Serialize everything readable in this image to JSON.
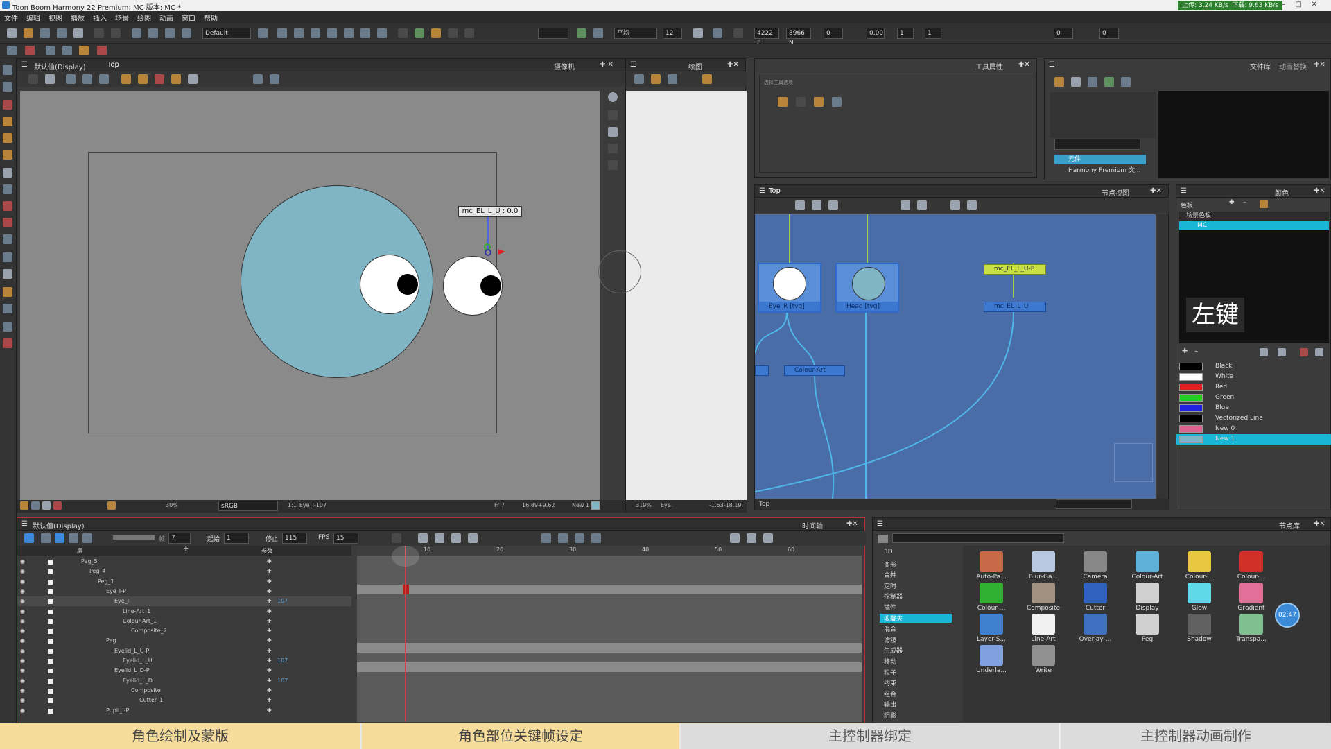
{
  "window": {
    "title": "Toon Boom Harmony 22 Premium: MC 版本: MC *",
    "net_up": "上传: 3.24 KB/s",
    "net_down": "下载: 9.63 KB/s"
  },
  "menu": [
    "文件",
    "编辑",
    "视图",
    "播放",
    "插入",
    "场景",
    "绘图",
    "动画",
    "窗口",
    "帮助"
  ],
  "toolbar": {
    "workspace": "Default",
    "smooth": "平均",
    "brush_size": "12",
    "coord_e": "4222 E",
    "coord_n": "8966 N",
    "f1": "0",
    "f2": "0.00",
    "f3": "1",
    "f4": "1",
    "f5": "0",
    "f6": "0"
  },
  "camera_panel": {
    "view_mode": "默认值(Display)",
    "tab": "Top",
    "title": "摄像机",
    "tooltip": "mc_EL_L_U : 0.0",
    "zoom": "30%",
    "color_space": "sRGB",
    "layer": "1:1_Eye_I-107",
    "frame_info": "Fr 7",
    "coords": "16.89+9.62",
    "new_label": "New 1"
  },
  "drawing_panel": {
    "title": "绘图",
    "zoom": "319%",
    "layer": "Eye_",
    "coords": "-1.63-18.19"
  },
  "tool_props": {
    "title": "工具属性",
    "subtitle": "选择工具选项"
  },
  "library_panel": {
    "title1": "文件库",
    "title2": "动画替换",
    "item1": "元件",
    "item2": "Harmony Premium 文..."
  },
  "node_view": {
    "tab": "Top",
    "title": "节点视图",
    "footer": "Top",
    "nodes": [
      "Eye_R [tvg]",
      "Head [tvg]",
      "mc_EL_L_U-P",
      "mc_EL_L_U",
      "Colour-Art"
    ]
  },
  "colour_panel": {
    "title": "颜色",
    "palette_tab": "色板",
    "scene_palette": "场景色板",
    "palette_item": "MC",
    "overlay_key": "左键",
    "swatches": [
      {
        "name": "Black",
        "color": "#000000"
      },
      {
        "name": "White",
        "color": "#ffffff"
      },
      {
        "name": "Red",
        "color": "#e02020"
      },
      {
        "name": "Green",
        "color": "#20d020"
      },
      {
        "name": "Blue",
        "color": "#2020e0"
      },
      {
        "name": "Vectorized Line",
        "color": "#000000"
      },
      {
        "name": "New 0",
        "color": "#e06090"
      },
      {
        "name": "New 1",
        "color": "#7fb5c4"
      }
    ]
  },
  "timeline": {
    "view_mode": "默认值(Display)",
    "title": "时间轴",
    "frame": "7",
    "start_label": "起始",
    "start": "1",
    "stop_label": "停止",
    "stop": "115",
    "fps_label": "FPS",
    "fps": "15",
    "col_layers": "层",
    "col_params": "参数",
    "ruler": [
      "10",
      "20",
      "30",
      "40",
      "50",
      "60"
    ],
    "layers": [
      "Peg_5",
      "Peg_4",
      "Peg_1",
      "Eye_I-P",
      "Eye_I",
      "Line-Art_1",
      "Colour-Art_1",
      "Composite_2",
      "Peg",
      "Eyelid_L_U-P",
      "Eyelid_L_U",
      "Eyelid_L_D-P",
      "Eyelid_L_D",
      "Composite",
      "Cutter_1",
      "Pupil_I-P"
    ],
    "layer_nums": {
      "4": "107",
      "10": "107",
      "12": "107"
    }
  },
  "node_library": {
    "title": "节点库",
    "categories": [
      "3D",
      "变形",
      "合并",
      "定时",
      "控制器",
      "插件",
      "收藏夹",
      "混合",
      "滤镜",
      "生成器",
      "移动",
      "粒子",
      "约束",
      "组合",
      "输出",
      "阴影"
    ],
    "selected_category": "收藏夹",
    "items": [
      {
        "name": "Auto-Pa...",
        "color": "#c86a48"
      },
      {
        "name": "Blur-Ga...",
        "color": "#b8c8e0"
      },
      {
        "name": "Camera",
        "color": "#888888"
      },
      {
        "name": "Colour-Art",
        "color": "#5fb0d8"
      },
      {
        "name": "Colour-...",
        "color": "#e8c840"
      },
      {
        "name": "Colour-...",
        "color": "#d03028"
      },
      {
        "name": "Colour-...",
        "color": "#30b030"
      },
      {
        "name": "Composite",
        "color": "#a09080"
      },
      {
        "name": "Cutter",
        "color": "#3060c0"
      },
      {
        "name": "Display",
        "color": "#d0d0d0"
      },
      {
        "name": "Glow",
        "color": "#60d8e8"
      },
      {
        "name": "Gradient",
        "color": "#e07098"
      },
      {
        "name": "Layer-S...",
        "color": "#4080d0"
      },
      {
        "name": "Line-Art",
        "color": "#f0f0f0"
      },
      {
        "name": "Overlay-...",
        "color": "#4070c0"
      },
      {
        "name": "Peg",
        "color": "#d0d0d0"
      },
      {
        "name": "Shadow",
        "color": "#606060"
      },
      {
        "name": "Transpa...",
        "color": "#80c090"
      },
      {
        "name": "Underla...",
        "color": "#80a0e0"
      },
      {
        "name": "Write",
        "color": "#909090"
      }
    ],
    "timer": "02:47"
  },
  "bottom_tabs": [
    "角色绘制及蒙版",
    "角色部位关键帧设定",
    "主控制器绑定",
    "主控制器动画制作"
  ]
}
